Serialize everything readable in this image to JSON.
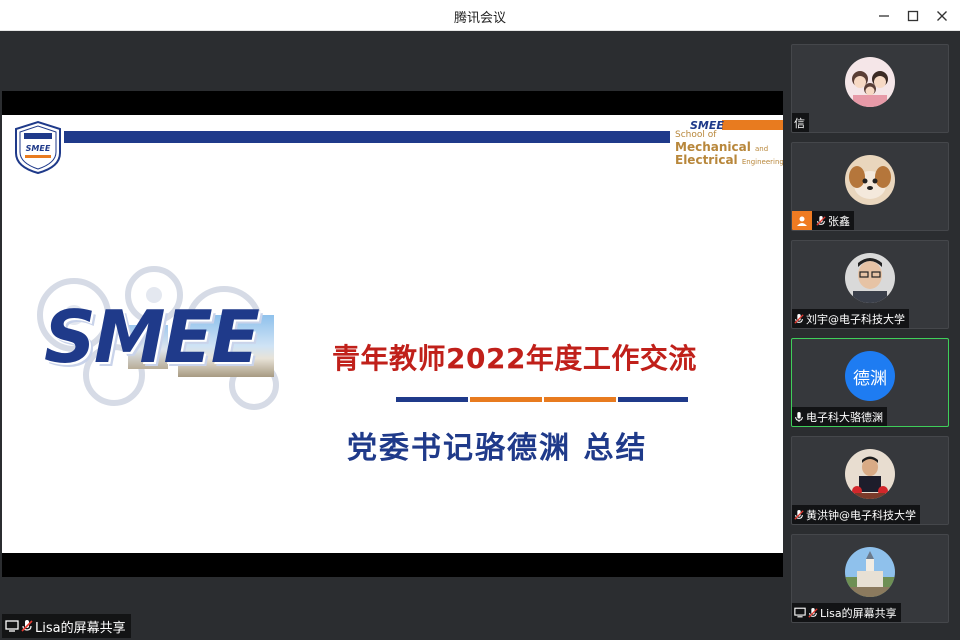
{
  "window": {
    "title": "腾讯会议"
  },
  "slide": {
    "school_line1": "School of",
    "school_line2": "Mechanical",
    "school_and": "and",
    "school_line3": "Electrical",
    "school_engineering": "Engineering",
    "logo_text": "SMEE",
    "headline": "青年教师2022年度工作交流",
    "subline": "党委书记骆德渊 总结"
  },
  "sharer": {
    "label": "Lisa的屏幕共享"
  },
  "participants": [
    {
      "name": "信",
      "avatar_type": "photo",
      "avatar_desc": "cartoon-family-avatar",
      "muted": false
    },
    {
      "name": "张鑫",
      "avatar_type": "photo",
      "avatar_desc": "puppy-avatar",
      "muted": true,
      "host": true
    },
    {
      "name": "刘宇@电子科技大学",
      "avatar_type": "photo",
      "avatar_desc": "man-with-glasses-avatar",
      "muted": true
    },
    {
      "name": "电子科大骆德渊",
      "avatar_type": "text",
      "avatar_text": "德渊",
      "muted": false,
      "active": true
    },
    {
      "name": "黄洪钟@电子科技大学",
      "avatar_type": "photo",
      "avatar_desc": "man-at-podium-avatar",
      "muted": true
    },
    {
      "name": "Lisa的屏幕共享",
      "avatar_type": "photo",
      "avatar_desc": "building-avatar",
      "muted": true,
      "screen_share": true
    }
  ],
  "colors": {
    "panel_bg": "#2b2d30",
    "accent_blue": "#1f3a8a",
    "accent_orange": "#e87b1f",
    "headline_red": "#c0201a",
    "active_border": "#3fcf5a",
    "avatar_blue": "#1e7cf2"
  }
}
